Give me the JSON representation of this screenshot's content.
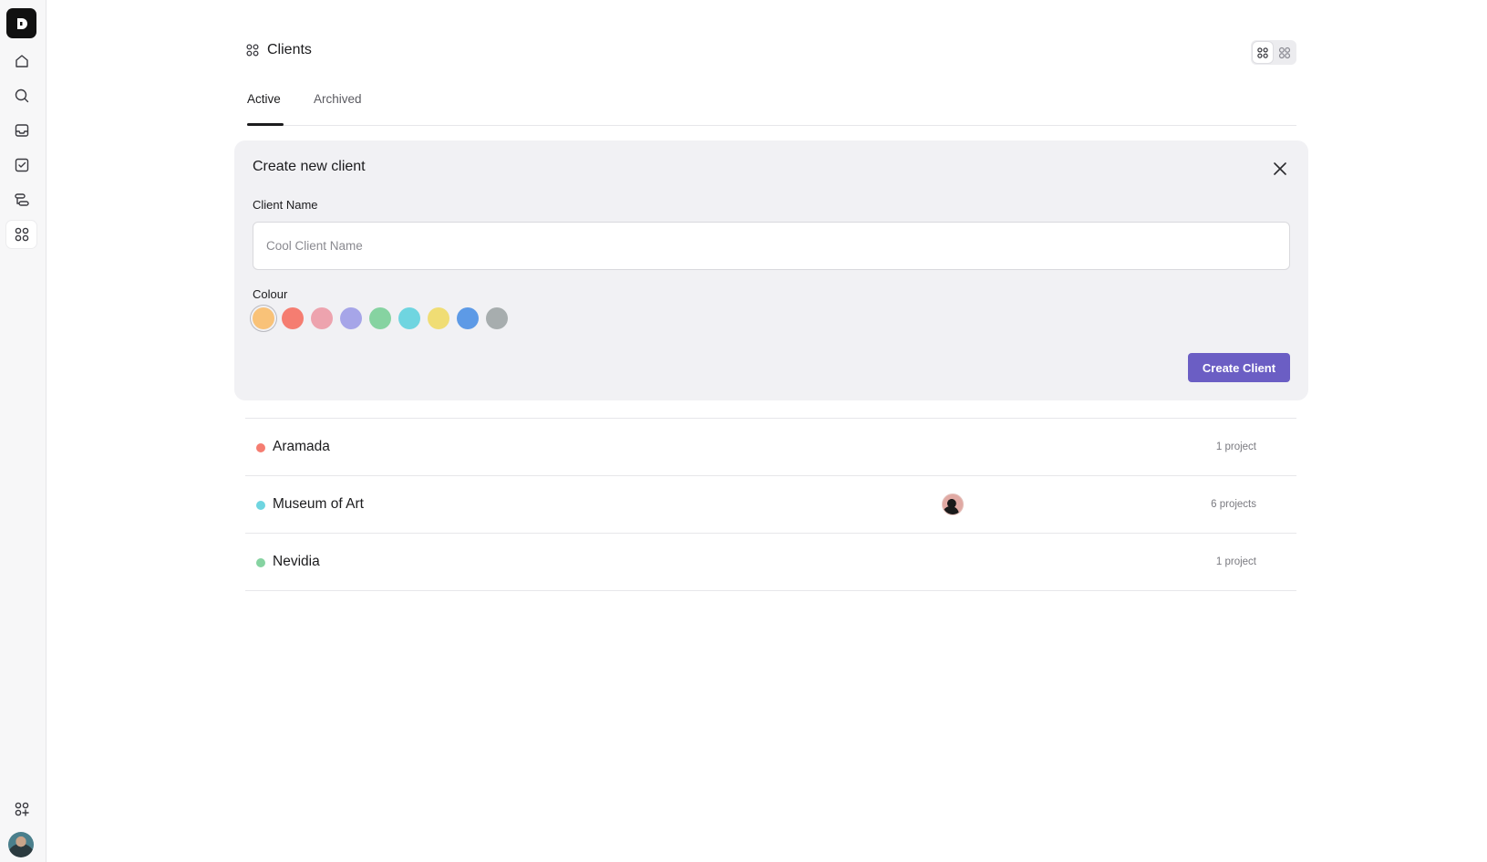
{
  "sidebar": {
    "logo_letter": "D",
    "items": [
      {
        "icon": "home-icon"
      },
      {
        "icon": "search-icon"
      },
      {
        "icon": "inbox-icon"
      },
      {
        "icon": "tasks-icon"
      },
      {
        "icon": "roadmap-icon"
      },
      {
        "icon": "clients-icon",
        "active": true
      }
    ],
    "bottom": [
      {
        "icon": "add-app-icon"
      },
      {
        "icon": "user-avatar"
      }
    ]
  },
  "header": {
    "title": "Clients",
    "title_icon": "clients-icon",
    "view_toggle": [
      "grid-view-icon",
      "card-view-icon"
    ]
  },
  "tabs": [
    {
      "label": "Active",
      "active": true
    },
    {
      "label": "Archived",
      "active": false
    }
  ],
  "create_form": {
    "title": "Create new client",
    "name_label": "Client Name",
    "name_value": "",
    "name_placeholder": "Cool Client Name",
    "colour_label": "Colour",
    "colours": [
      "#f9c278",
      "#f57d71",
      "#eda3ae",
      "#a6a5e8",
      "#86d3a1",
      "#6fd5e0",
      "#f0dd74",
      "#5d9ae6",
      "#a7adae"
    ],
    "selected_colour_index": 0,
    "submit_label": "Create Client"
  },
  "clients": [
    {
      "name": "Aramada",
      "color": "#f57d71",
      "count": "1 project",
      "has_member": false
    },
    {
      "name": "Museum of Art",
      "color": "#6fd5e0",
      "count": "6 projects",
      "has_member": true
    },
    {
      "name": "Nevidia",
      "color": "#86d3a1",
      "count": "1 project",
      "has_member": false
    }
  ],
  "colors": {
    "accent": "#6b5ec4",
    "sidebar_bg": "#f7f7f8",
    "card_bg": "#f1f1f4"
  }
}
